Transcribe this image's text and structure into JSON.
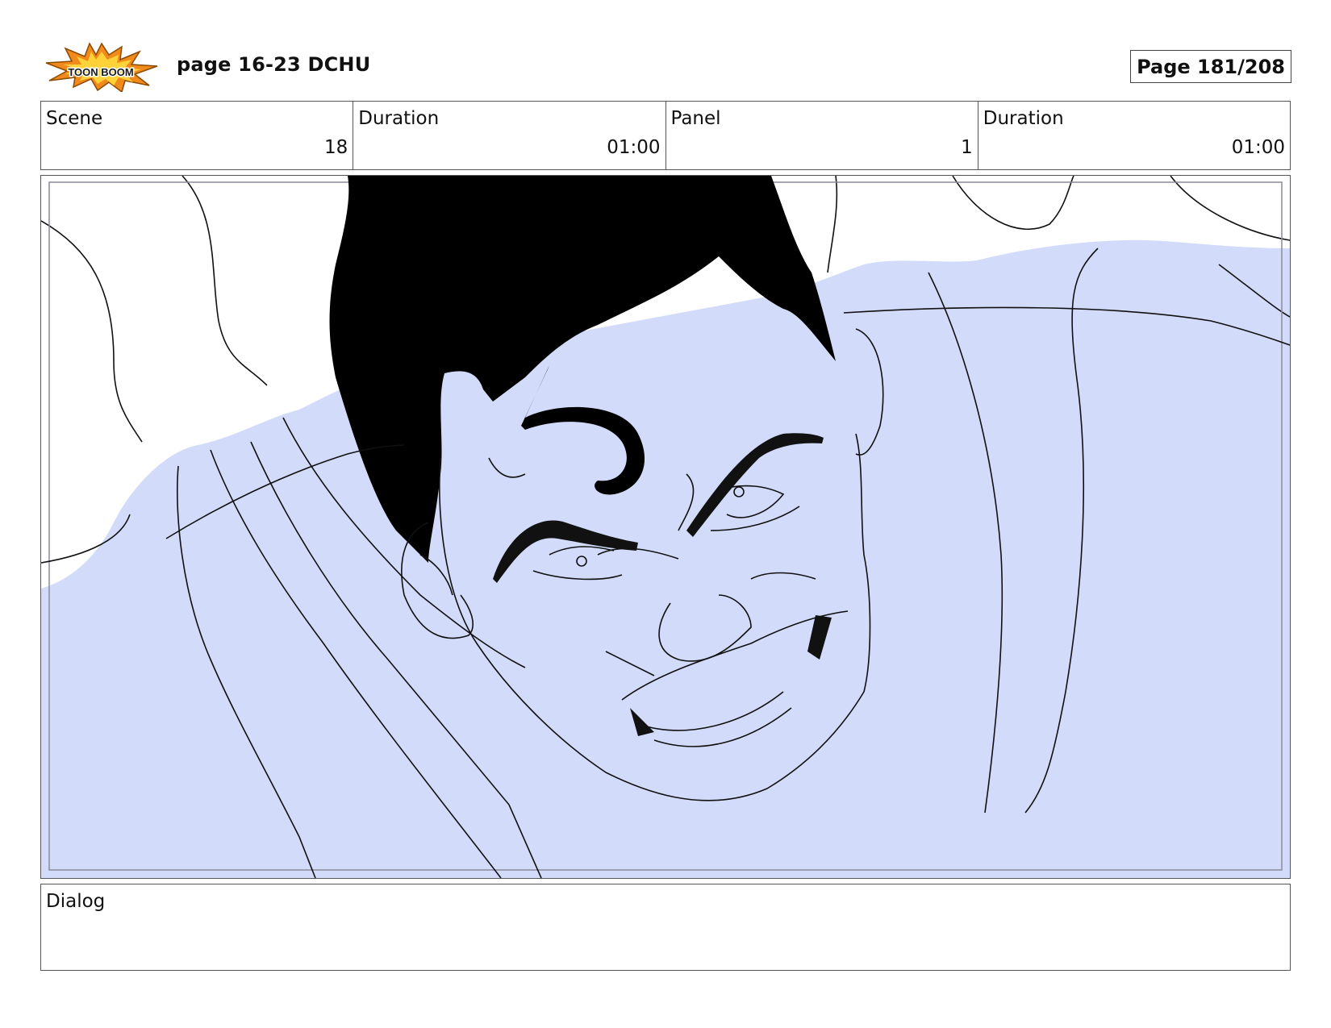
{
  "header": {
    "logo_text": "TOON BOOM",
    "document_title": "page 16-23 DCHU",
    "page_label": "Page 181/208"
  },
  "info": {
    "scene_label": "Scene",
    "scene_value": "18",
    "scene_duration_label": "Duration",
    "scene_duration_value": "01:00",
    "panel_label": "Panel",
    "panel_value": "1",
    "panel_duration_label": "Duration",
    "panel_duration_value": "01:00"
  },
  "panel": {
    "fill_color": "#d2dcfa",
    "hair_color": "#000000",
    "line_color": "#111111",
    "safe_frame_color": "#8a8a9a"
  },
  "dialog": {
    "label": "Dialog",
    "text": ""
  }
}
